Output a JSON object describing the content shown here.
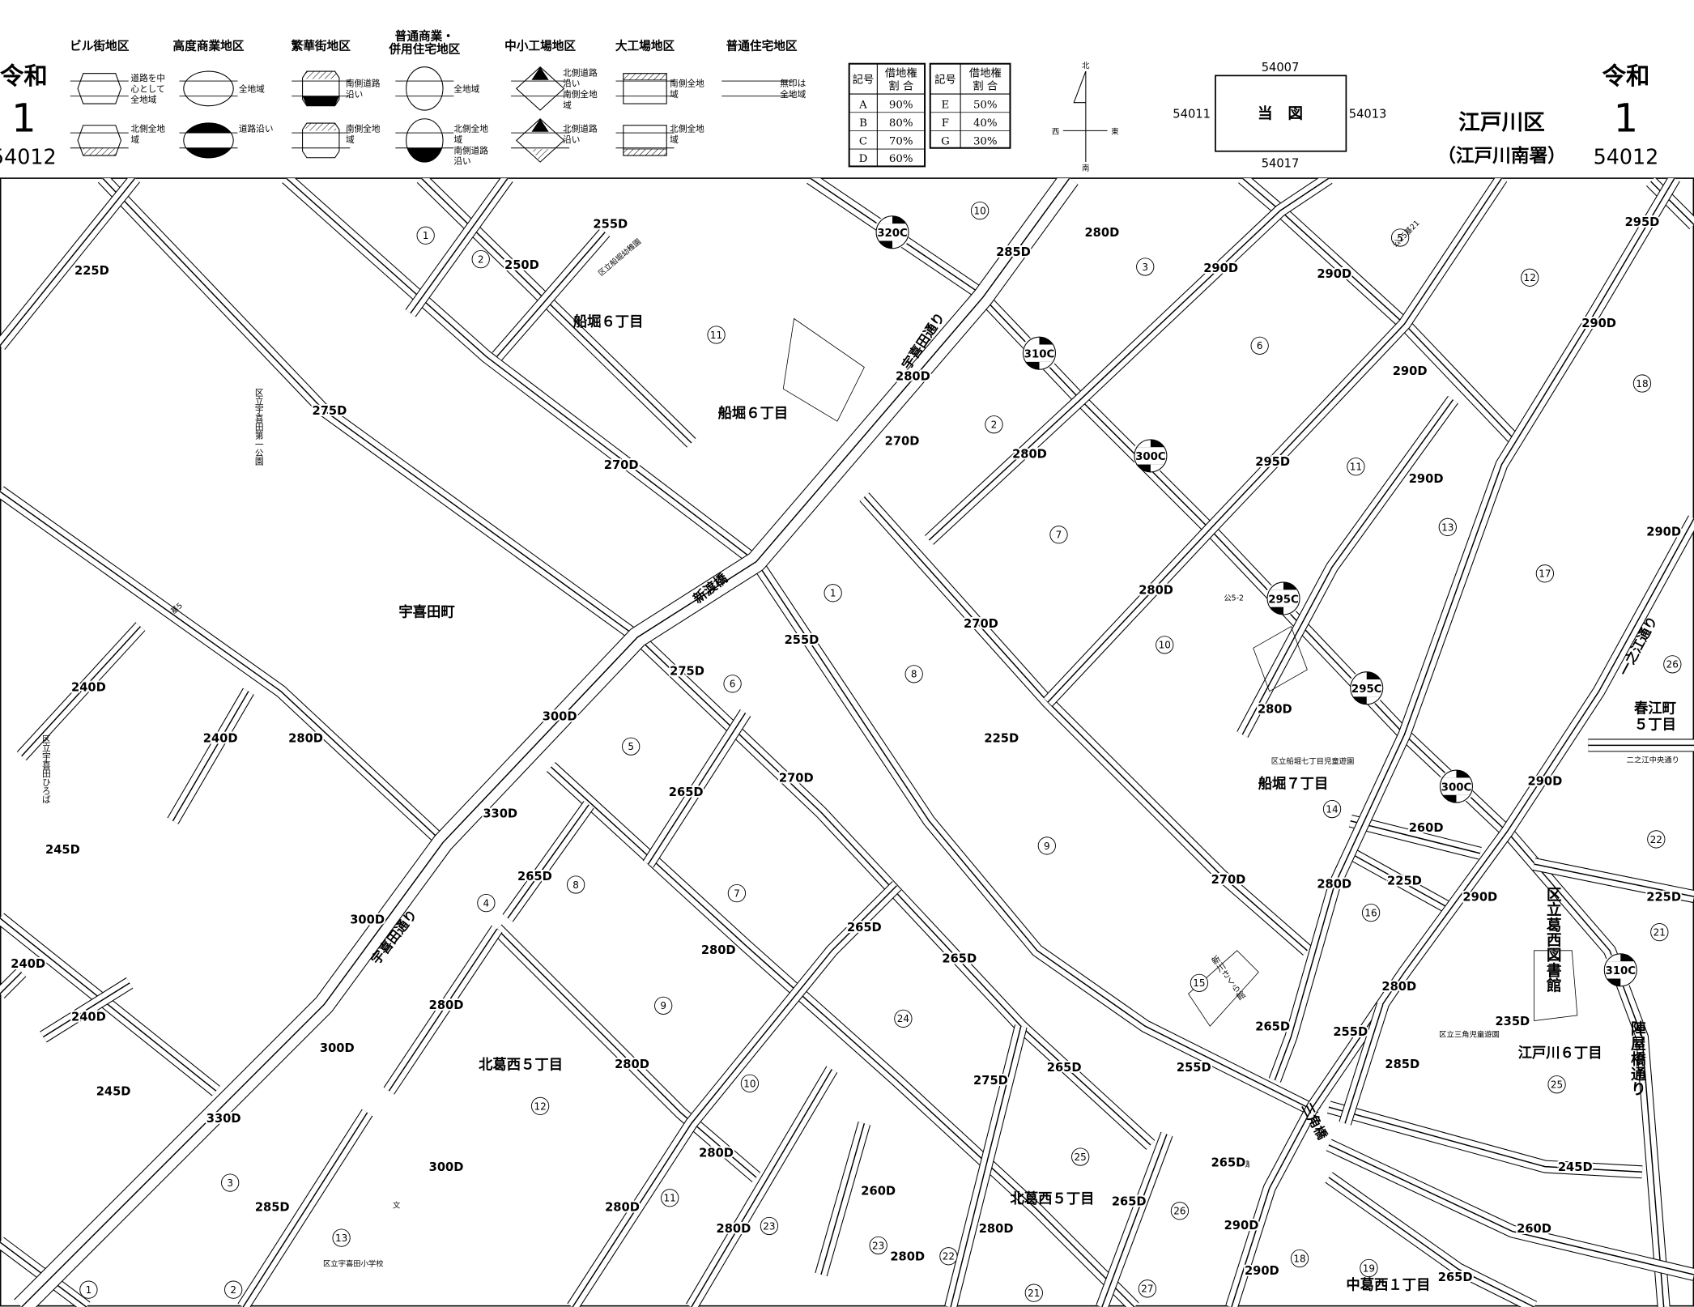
{
  "header": {
    "era": "令和",
    "year": "1",
    "sheet_number": "54012",
    "ward": "江戸川区",
    "tax_office": "（江戸川南署）"
  },
  "legend": {
    "districts": [
      {
        "name": [
          "ビル街地区"
        ],
        "notes_top": [
          "道路を中",
          "心として",
          "全地域"
        ],
        "notes_bottom": [
          "北側全地",
          "域"
        ]
      },
      {
        "name": [
          "高度商業地区"
        ],
        "notes_top": [
          "全地域"
        ],
        "notes_bottom": [
          "道路沿い"
        ]
      },
      {
        "name": [
          "繁華街地区"
        ],
        "notes_top": [
          "南側道路",
          "沿い"
        ],
        "notes_bottom": [
          "南側全地",
          "域"
        ]
      },
      {
        "name": [
          "普通商業・",
          "併用住宅地区"
        ],
        "notes_top": [
          "全地域"
        ],
        "notes_bottom": [
          "北側全地",
          "域",
          "南側道路",
          "沿い"
        ]
      },
      {
        "name": [
          "中小工場地区"
        ],
        "notes_top": [
          "北側道路",
          "沿い",
          "南側全地",
          "域"
        ],
        "notes_bottom": [
          "北側道路",
          "沿い"
        ]
      },
      {
        "name": [
          "大工場地区"
        ],
        "notes_top": [
          "南側全地",
          "域"
        ],
        "notes_bottom": [
          "北側全地",
          "域"
        ]
      },
      {
        "name": [
          "普通住宅地区"
        ],
        "notes_top": [
          "無印は",
          "全地域"
        ],
        "notes_bottom": []
      }
    ]
  },
  "leasehold_table": {
    "header_symbol": "記号",
    "header_ratio": [
      "借地権",
      "割 合"
    ],
    "left_rows": [
      [
        "A",
        "90%"
      ],
      [
        "B",
        "80%"
      ],
      [
        "C",
        "70%"
      ],
      [
        "D",
        "60%"
      ]
    ],
    "right_rows": [
      [
        "E",
        "50%"
      ],
      [
        "F",
        "40%"
      ],
      [
        "G",
        "30%"
      ]
    ]
  },
  "compass": {
    "north": "北",
    "south": "南",
    "east": "東",
    "west": "西"
  },
  "index_map": {
    "current": "当　図",
    "north": "54007",
    "south": "54017",
    "west": "54011",
    "east": "54013"
  },
  "map": {
    "route_prices": [
      "225D",
      "255D",
      "250D",
      "320C",
      "285D",
      "280D",
      "290D",
      "295D",
      "290D",
      "290D",
      "275D",
      "270D",
      "280D",
      "310C",
      "270D",
      "280D",
      "300C",
      "290D",
      "295D",
      "290D",
      "290D",
      "280D",
      "270D",
      "295C",
      "255D",
      "275D",
      "240D",
      "300D",
      "295C",
      "280D",
      "240D",
      "280D",
      "225D",
      "270D",
      "265D",
      "300C",
      "290D",
      "330D",
      "260D",
      "245D",
      "280D",
      "225D",
      "225D",
      "265D",
      "270D",
      "290D",
      "300D",
      "265D",
      "280D",
      "240D",
      "265D",
      "310C",
      "280D",
      "240D",
      "280D",
      "235D",
      "265D",
      "255D",
      "300D",
      "285D",
      "275D",
      "265D",
      "280D",
      "255D",
      "245D",
      "330D",
      "265D",
      "245D",
      "280D",
      "300D",
      "260D",
      "265D",
      "285D",
      "280D",
      "290D",
      "260D",
      "280D",
      "280D",
      "280D",
      "290D",
      "265D"
    ],
    "block_numbers": [
      "1",
      "2",
      "10",
      "3",
      "5",
      "12",
      "11",
      "6",
      "18",
      "2",
      "11",
      "7",
      "13",
      "1",
      "17",
      "10",
      "8",
      "6",
      "26",
      "5",
      "14",
      "22",
      "9",
      "7",
      "8",
      "4",
      "16",
      "21",
      "15",
      "9",
      "24",
      "10",
      "12",
      "25",
      "3",
      "25",
      "26",
      "13",
      "11",
      "23",
      "23",
      "22",
      "18",
      "19",
      "1",
      "2",
      "21",
      "27"
    ],
    "place_names": [
      "船堀６丁目",
      "船堀６丁目",
      "宇喜田町",
      "船堀７丁目",
      "北葛西５丁目",
      "北葛西５丁目",
      "江戸川６丁目",
      "中葛西１丁目",
      "春江町",
      "５丁目",
      "区立宇喜田小学校",
      "宇喜田通り",
      "宇喜田通り",
      "新渡橋",
      "桜橋",
      "三角橋",
      "一之江通り",
      "区立葛西図書館",
      "陣屋橋通り",
      "区立宇喜田第一公園",
      "区立宇喜田ひろば",
      "区立船堀幼稚園",
      "区立船堀七丁目児童遊園",
      "区立三角児童遊園",
      "新川さくら館",
      "公5-2",
      "文",
      "二之江中央通り",
      "基5",
      "公25基21"
    ]
  }
}
